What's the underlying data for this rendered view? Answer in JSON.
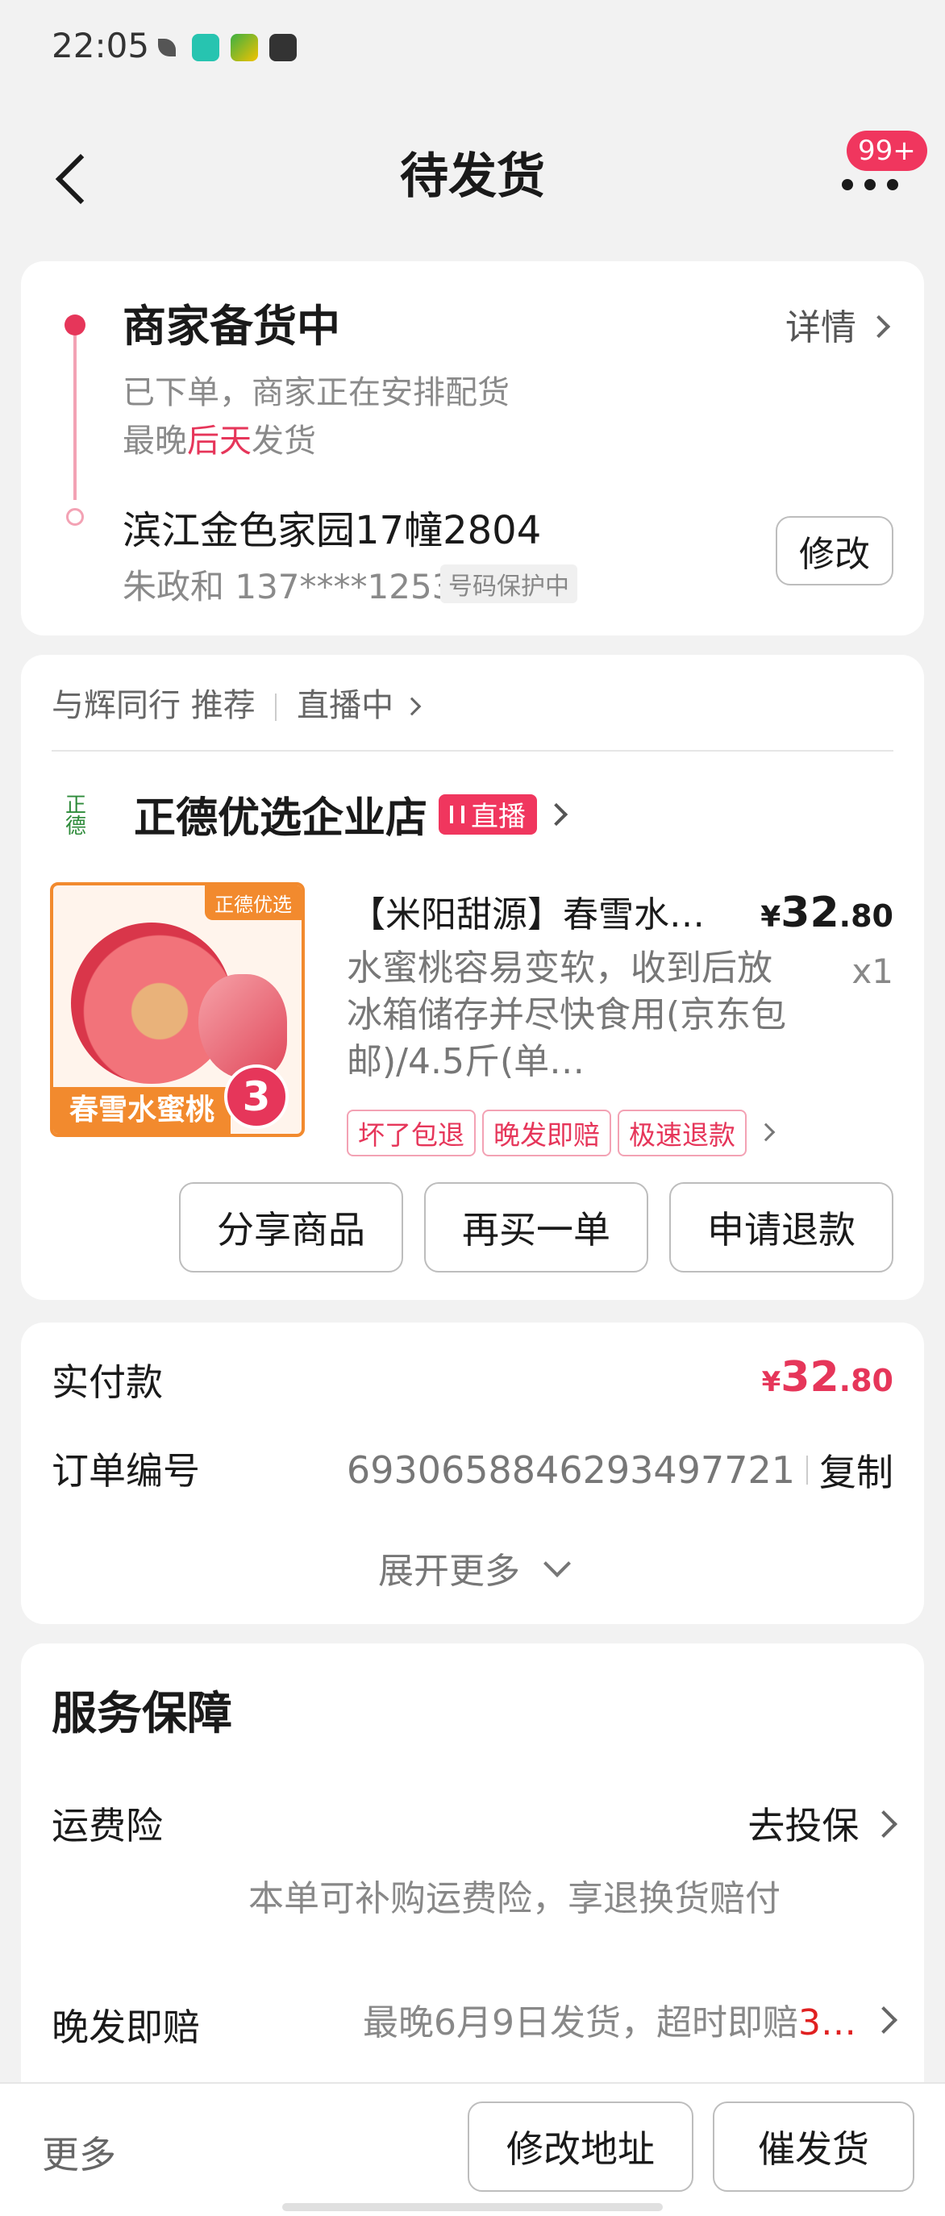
{
  "status_bar": {
    "time": "22:05"
  },
  "header": {
    "title": "待发货",
    "badge": "99+"
  },
  "progress": {
    "title": "商家备货中",
    "detail_link": "详情",
    "desc": "已下单，商家正在安排配货",
    "ship_prefix": "最晚",
    "ship_highlight": "后天",
    "ship_suffix": "发货",
    "address": "滨江金色家园17幢2804",
    "contact": "朱政和 137****1253",
    "privacy_tag": "号码保护中",
    "modify_button": "修改"
  },
  "shop": {
    "recommend_from": "与辉同行 推荐",
    "live_link": "直播中",
    "logo_text": "正德",
    "name": "正德优选企业店",
    "live_badge": "直播",
    "product": {
      "image_brand": "正德优选",
      "image_title": "春雪水蜜桃",
      "image_number": "3",
      "title": "【米阳甜源】春雪水…",
      "desc": "水蜜桃容易变软，收到后放冰箱储存并尽快食用(京东包邮)/4.5斤(单…",
      "price_symbol": "¥",
      "price_int": "32",
      "price_dec": ".80",
      "qty": "x1",
      "tags": [
        "坏了包退",
        "晚发即赔",
        "极速退款"
      ]
    },
    "buttons": {
      "share": "分享商品",
      "rebuy": "再买一单",
      "refund": "申请退款"
    }
  },
  "payment": {
    "paid_label": "实付款",
    "price_symbol": "¥",
    "price_int": "32",
    "price_dec": ".80",
    "order_label": "订单编号",
    "order_number": "6930658846293497721",
    "copy": "复制",
    "expand": "展开更多"
  },
  "service": {
    "title": "服务保障",
    "freight_label": "运费险",
    "freight_action": "去投保",
    "freight_desc": "本单可补购运费险，享退换货赔付",
    "late_label": "晚发即赔",
    "late_desc_prefix": "最晚6月9日发货，超时即赔",
    "late_desc_highlight": "3…"
  },
  "bottom_bar": {
    "more": "更多",
    "modify_address": "修改地址",
    "urge": "催发货"
  },
  "colors": {
    "accent": "#e6365a",
    "background": "#f2f2f2",
    "card": "#ffffff"
  }
}
